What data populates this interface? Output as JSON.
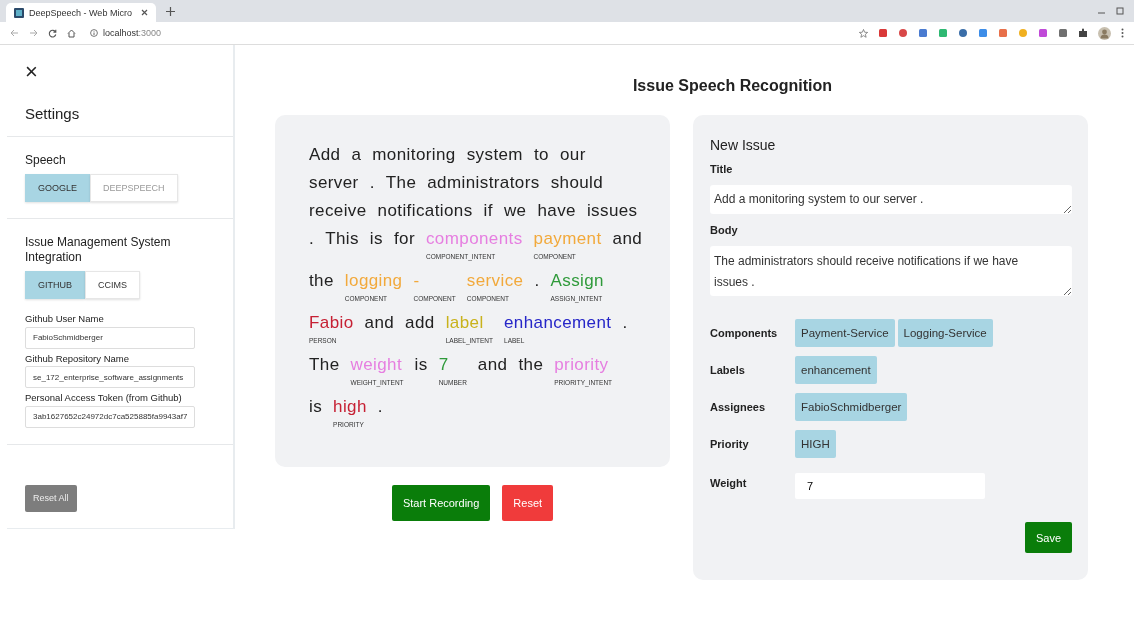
{
  "browser": {
    "tab_title": "DeepSpeech - Web Micro",
    "url_host": "localhost",
    "url_port": ":3000"
  },
  "sidebar": {
    "close": "×",
    "title": "Settings",
    "speech": {
      "heading": "Speech",
      "options": [
        {
          "label": "GOOGLE",
          "selected": true,
          "disabled": false
        },
        {
          "label": "DEEPSPEECH",
          "selected": false,
          "disabled": true
        }
      ]
    },
    "ims": {
      "heading": "Issue Management System Integration",
      "options": [
        {
          "label": "GITHUB",
          "selected": true,
          "disabled": false
        },
        {
          "label": "CCIMS",
          "selected": false,
          "disabled": false
        }
      ],
      "fields": [
        {
          "label": "Github User Name",
          "value": "FabioSchmidberger"
        },
        {
          "label": "Github Repository Name",
          "value": "se_172_enterprise_software_assignments"
        },
        {
          "label": "Personal Access Token (from Github)",
          "value": "3ab1627652c24972dc7ca525885fa9943af7"
        }
      ]
    },
    "reset_all": "Reset All"
  },
  "title": "Issue Speech Recognition",
  "transcript": {
    "lines": [
      [
        {
          "text": "Add"
        },
        {
          "text": "a"
        },
        {
          "text": "monitoring"
        },
        {
          "text": "system"
        },
        {
          "text": "to"
        },
        {
          "text": "our"
        }
      ],
      [
        {
          "text": "server"
        },
        {
          "text": "."
        },
        {
          "text": "The"
        },
        {
          "text": "administrators"
        },
        {
          "text": "should"
        }
      ],
      [
        {
          "text": "receive"
        },
        {
          "text": "notifications"
        },
        {
          "text": "if"
        },
        {
          "text": "we"
        },
        {
          "text": "have"
        },
        {
          "text": "issues"
        }
      ],
      [
        {
          "text": "."
        },
        {
          "text": "This"
        },
        {
          "text": "is"
        },
        {
          "text": "for"
        },
        {
          "text": "components",
          "tag": "COMPONENT_INTENT",
          "color": "#e67ee0"
        },
        {
          "text": "payment",
          "tag": "COMPONENT",
          "color": "#f2a93b"
        },
        {
          "text": "and"
        }
      ],
      [
        {
          "text": "the"
        },
        {
          "text": "logging",
          "tag": "COMPONENT",
          "color": "#f2a93b"
        },
        {
          "text": "-",
          "tag": "COMPONENT",
          "color": "#f2a93b"
        },
        {
          "text": "service",
          "tag": "COMPONENT",
          "color": "#f2a93b"
        },
        {
          "text": "."
        },
        {
          "text": "Assign",
          "tag": "ASSIGN_INTENT",
          "color": "#2f9a3a"
        }
      ],
      [
        {
          "text": "Fabio",
          "tag": "PERSON",
          "color": "#c62033"
        },
        {
          "text": "and"
        },
        {
          "text": "add"
        },
        {
          "text": "label",
          "tag": "LABEL_INTENT",
          "color": "#c9b21c"
        },
        {
          "text": "enhancement",
          "tag": "LABEL",
          "color": "#2626c8"
        },
        {
          "text": "."
        }
      ],
      [
        {
          "text": "The"
        },
        {
          "text": "weight",
          "tag": "WEIGHT_INTENT",
          "color": "#e67ee0"
        },
        {
          "text": "is"
        },
        {
          "text": "7",
          "tag": "NUMBER",
          "color": "#2f9a3a"
        },
        {
          "text": "and"
        },
        {
          "text": "the"
        },
        {
          "text": "priority",
          "tag": "PRIORITY_INTENT",
          "color": "#e67ee0"
        }
      ],
      [
        {
          "text": "is"
        },
        {
          "text": "high",
          "tag": "PRIORITY",
          "color": "#c62033"
        },
        {
          "text": "."
        }
      ]
    ]
  },
  "start_recording": "Start Recording",
  "reset": "Reset",
  "issue": {
    "heading": "New Issue",
    "title_label": "Title",
    "title_value": "Add a monitoring system to our server .",
    "body_label": "Body",
    "body_value": "The administrators should receive notifications if we have issues .",
    "rows": [
      {
        "label": "Components",
        "chips": [
          "Payment-Service",
          "Logging-Service"
        ]
      },
      {
        "label": "Labels",
        "chips": [
          "enhancement"
        ]
      },
      {
        "label": "Assignees",
        "chips": [
          "FabioSchmidberger"
        ]
      },
      {
        "label": "Priority",
        "chips": [
          "HIGH"
        ]
      }
    ],
    "weight_label": "Weight",
    "weight_value": "7",
    "save": "Save"
  }
}
